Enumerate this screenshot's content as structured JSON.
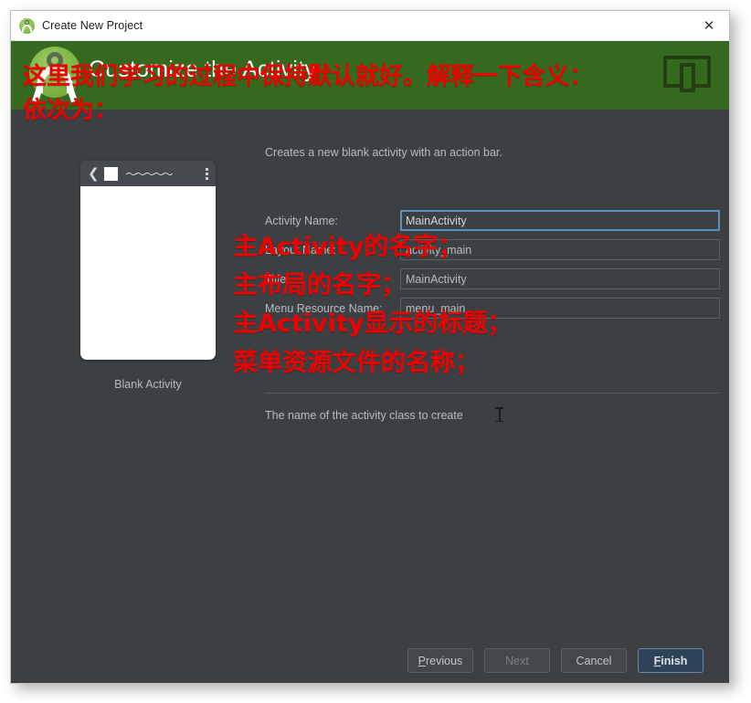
{
  "window": {
    "title": "Create New Project",
    "title_icon": "android-studio-icon",
    "close_icon": "✕"
  },
  "header": {
    "title": "Customize the Activity",
    "logo_icon": "android-studio-logo",
    "device_icon": "tablet-phone-icon",
    "background_color": "#35691f"
  },
  "annotations": {
    "color": "#f10000",
    "top": [
      "这里我们学习的过程中保持默认就好。解释一下含义：",
      "依次为："
    ],
    "fields": [
      "主Activity的名字；",
      "主布局的名字；",
      "主Activity显示的标题；",
      "菜单资源文件的名称；"
    ]
  },
  "main": {
    "description": "Creates a new blank activity with an action bar.",
    "preview": {
      "label": "Blank Activity",
      "appbar": {
        "back_icon": "❮",
        "square_icon": "white-square-icon",
        "zigzag_icon": "〜〜〜〜〜",
        "overflow_icon": "three-dot-menu-icon"
      }
    },
    "fields": [
      {
        "label": "Activity Name:",
        "value": "MainActivity",
        "focused": true
      },
      {
        "label": "Layout Name:",
        "value": "activity_main",
        "focused": false
      },
      {
        "label": "Title:",
        "value": "MainActivity",
        "focused": false
      },
      {
        "label": "Menu Resource Name:",
        "value": "menu_main",
        "focused": false
      }
    ],
    "hint": "The name of the activity class to create"
  },
  "footer": {
    "buttons": [
      {
        "label": "Previous",
        "mnemonic": "P",
        "state": "enabled"
      },
      {
        "label": "Next",
        "mnemonic": "",
        "state": "disabled"
      },
      {
        "label": "Cancel",
        "mnemonic": "",
        "state": "enabled"
      },
      {
        "label": "Finish",
        "mnemonic": "F",
        "state": "primary"
      }
    ]
  }
}
